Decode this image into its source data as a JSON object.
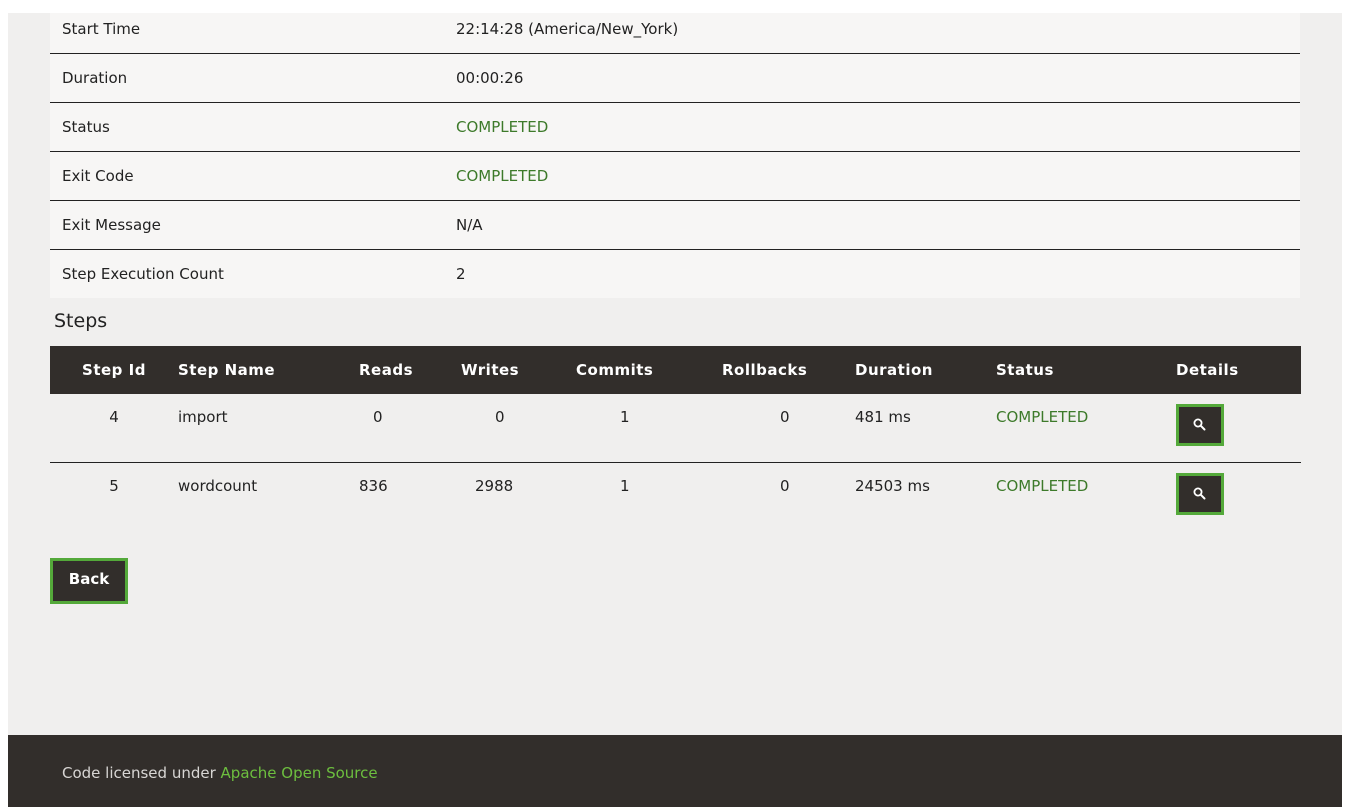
{
  "properties": [
    {
      "label": "Start Time",
      "value": "22:14:28 (America/New_York)"
    },
    {
      "label": "Duration",
      "value": "00:00:26"
    },
    {
      "label": "Status",
      "value": "COMPLETED"
    },
    {
      "label": "Exit Code",
      "value": "COMPLETED"
    },
    {
      "label": "Exit Message",
      "value": "N/A"
    },
    {
      "label": "Step Execution Count",
      "value": "2"
    }
  ],
  "steps": {
    "title": "Steps",
    "columns": [
      "Step Id",
      "Step Name",
      "Reads",
      "Writes",
      "Commits",
      "Rollbacks",
      "Duration",
      "Status",
      "Details"
    ],
    "rows": [
      {
        "id": "4",
        "name": "import",
        "reads": "0",
        "writes": "0",
        "commits": "1",
        "rollbacks": "0",
        "duration": "481 ms",
        "status": "COMPLETED",
        "details_icon": "search-icon"
      },
      {
        "id": "5",
        "name": "wordcount",
        "reads": "836",
        "writes": "2988",
        "commits": "1",
        "rollbacks": "0",
        "duration": "24503 ms",
        "status": "COMPLETED",
        "details_icon": "search-icon"
      }
    ]
  },
  "back_label": "Back",
  "footer": {
    "text": "Code licensed under ",
    "link": "Apache Open Source"
  },
  "colors": {
    "status_green": "#3d7a2a",
    "accent_green": "#54a93a",
    "dark": "#322e2b"
  }
}
